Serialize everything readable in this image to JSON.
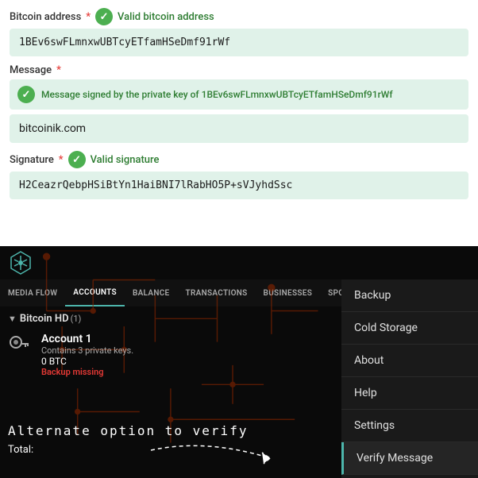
{
  "top": {
    "bitcoin_address_label": "Bitcoin address",
    "required_marker": "*",
    "valid_address_text": "Valid bitcoin address",
    "bitcoin_address_value": "1BEv6swFLmnxwUBTcyETfamHSeDmf91rWf",
    "message_label": "Message",
    "message_signed_text": "Message signed by the private key of 1BEv6swFLmnxwUBTcyETfamHSeDmf91rWf",
    "message_value": "bitcoinik.com",
    "signature_label": "Signature",
    "valid_signature_text": "Valid signature",
    "signature_value": "H2CeazrQebpHSiBtYn1HaiBNI7lRabHO5P+sVJyhdSsc"
  },
  "bottom": {
    "nav_items": [
      {
        "label": "MEDIA FLOW",
        "active": false
      },
      {
        "label": "ACCOUNTS",
        "active": true
      },
      {
        "label": "BALANCE",
        "active": false
      },
      {
        "label": "TRANSACTIONS",
        "active": false
      },
      {
        "label": "BUSINESSES",
        "active": false
      },
      {
        "label": "SPORTS BETTING",
        "active": false
      }
    ],
    "bitcoin_hd_label": "Bitcoin HD",
    "bitcoin_hd_count": "(1)",
    "account_title": "Account 1",
    "account_sub": "Contains 3 private keys.",
    "account_btc": "0 BTC",
    "backup_missing": "Backup missing",
    "verify_text": "Alternate option to verify",
    "total_label": "Total:",
    "menu_items": [
      {
        "label": "Backup",
        "active": false
      },
      {
        "label": "Cold Storage",
        "active": false
      },
      {
        "label": "About",
        "active": false
      },
      {
        "label": "Help",
        "active": false
      },
      {
        "label": "Settings",
        "active": false
      },
      {
        "label": "Verify Message",
        "active": true
      }
    ]
  }
}
